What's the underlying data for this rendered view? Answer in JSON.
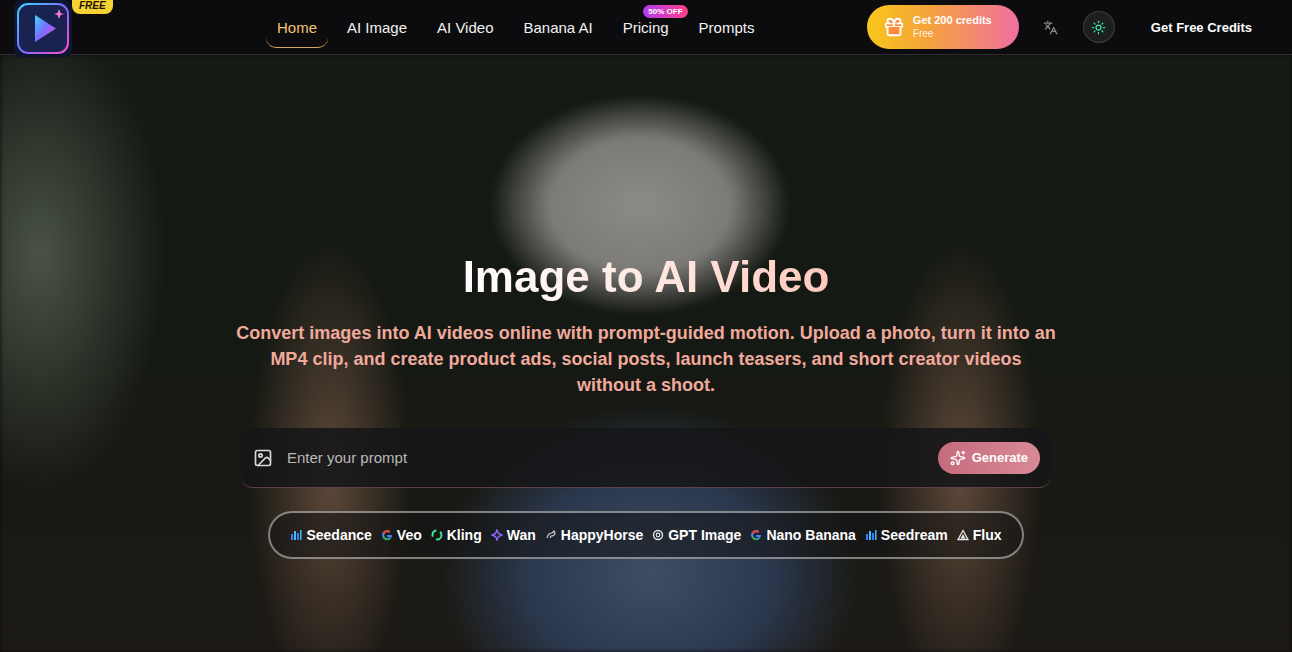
{
  "header": {
    "logo_badge": "FREE",
    "nav": [
      {
        "label": "Home",
        "selected": true
      },
      {
        "label": "AI Image",
        "selected": false
      },
      {
        "label": "AI Video",
        "selected": false
      },
      {
        "label": "Banana AI",
        "selected": false
      },
      {
        "label": "Pricing",
        "selected": false,
        "badge": "50% OFF"
      },
      {
        "label": "Prompts",
        "selected": false
      }
    ],
    "promo": {
      "title": "Get 200 credits",
      "subtitle": "Free"
    },
    "cta": "Get Free Credits"
  },
  "hero": {
    "title": "Image to AI Video",
    "subtitle": "Convert images into AI videos online with prompt-guided motion. Upload a photo, turn it into an MP4 clip, and create product ads, social posts, launch teasers, and short creator videos without a shoot."
  },
  "prompt": {
    "placeholder": "Enter your prompt",
    "button": "Generate"
  },
  "models": [
    "Seedance",
    "Veo",
    "Kling",
    "Wan",
    "HappyHorse",
    "GPT Image",
    "Nano Banana",
    "Seedream",
    "Flux"
  ]
}
